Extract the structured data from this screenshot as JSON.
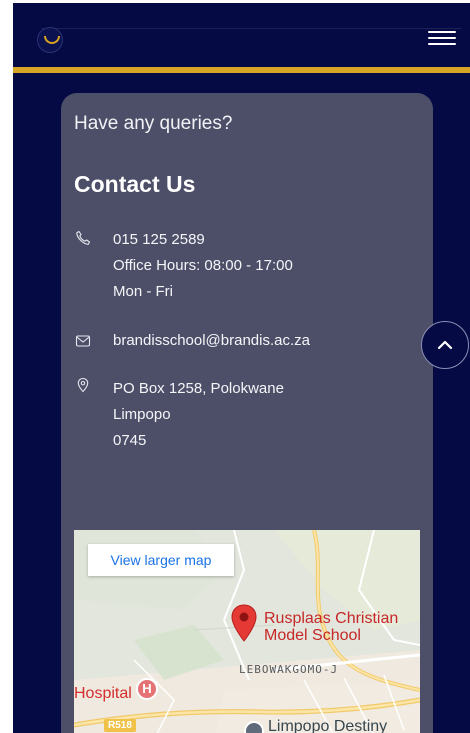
{
  "header": {
    "logo_name": "school-crest-logo",
    "menu_icon": "hamburger-menu-icon"
  },
  "contact": {
    "intro": "Have any queries?",
    "title": "Contact Us",
    "phone": {
      "icon": "phone-icon",
      "lines": [
        "015 125 2589",
        "Office Hours: 08:00 - 17:00",
        "Mon - Fri"
      ]
    },
    "email": {
      "icon": "mail-icon",
      "address": "brandisschool@brandis.ac.za"
    },
    "address": {
      "icon": "location-pin-icon",
      "lines": [
        "PO Box 1258, Polokwane",
        "Limpopo",
        "0745"
      ]
    }
  },
  "map": {
    "button_label": "View larger map",
    "place_name_line1": "Rusplaas Christian",
    "place_name_line2": "Model School",
    "area_label": "LEBOWAKGOMO-J",
    "hospital_label": "Hospital",
    "road_label": "R518",
    "destination_label": "Limpopo Destiny"
  },
  "scroll_top": {
    "icon": "chevron-up-icon"
  },
  "colors": {
    "page_bg": "#050a45",
    "card_bg": "#4d4f69",
    "accent_gold": "#d8a525",
    "map_pin_red": "#e53935",
    "link_blue": "#1a73e8"
  }
}
